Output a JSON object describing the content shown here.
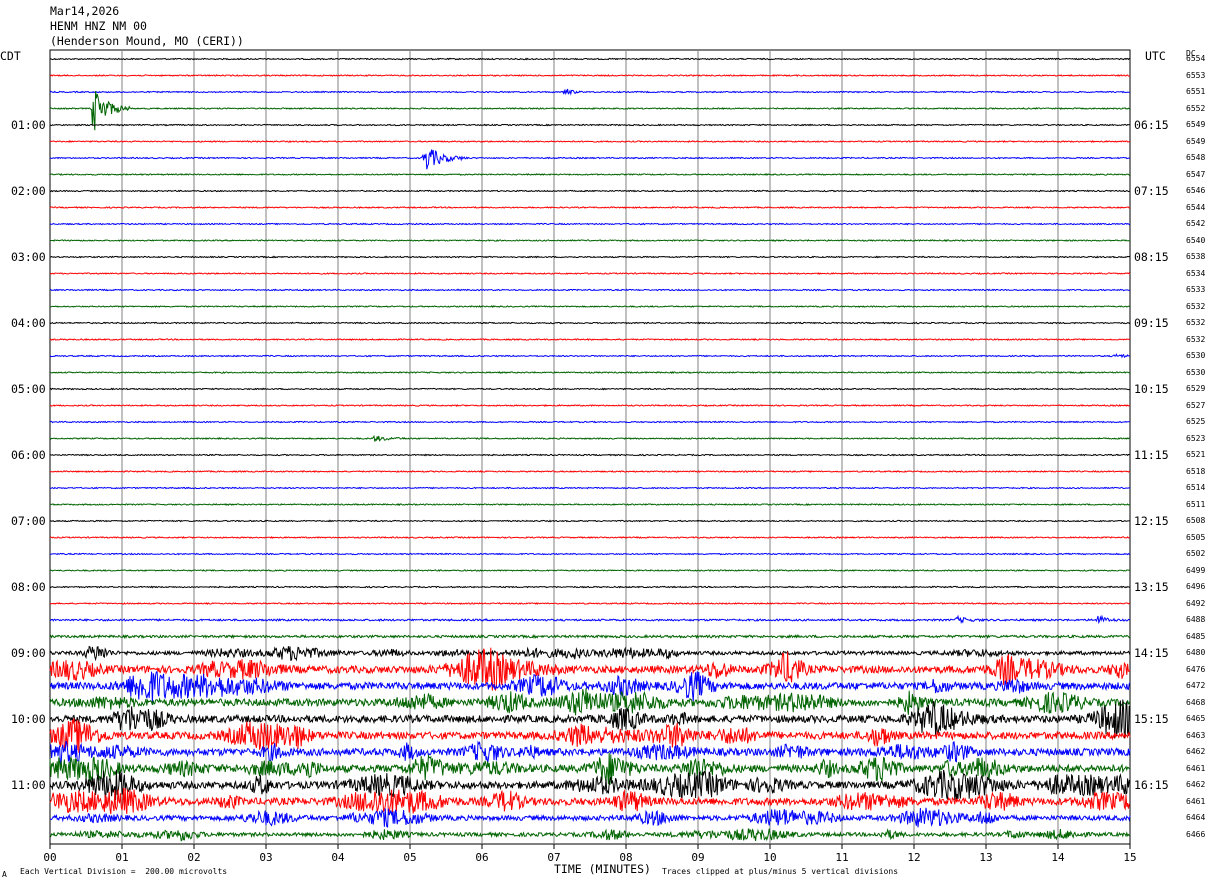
{
  "header": {
    "date": "Mar14,2026",
    "station": "HENM HNZ NM 00",
    "location": "(Henderson Mound, MO (CERI))"
  },
  "labels": {
    "left_tz": "CDT",
    "right_tz": "UTC",
    "dc_header": "DC",
    "xlabel": "TIME (MINUTES)",
    "scale_note": "Each Vertical Division =  200.00 microvolts",
    "clip_note": "Traces clipped at plus/minus 5 vertical divisions",
    "corner_mark": "A"
  },
  "colors": {
    "trace_cycle": [
      "#000000",
      "#ff0000",
      "#0000ff",
      "#006400"
    ],
    "grid": "#808080"
  },
  "chart_data": {
    "type": "line",
    "title": "HENM HNZ NM 00",
    "xlabel": "TIME (MINUTES)",
    "xlim": [
      0,
      15
    ],
    "x_ticks": [
      "00",
      "01",
      "02",
      "03",
      "04",
      "05",
      "06",
      "07",
      "08",
      "09",
      "10",
      "11",
      "12",
      "13",
      "14",
      "15"
    ],
    "lines_per_hour": 4,
    "line_count": 48,
    "left_hour_labels": [
      "01:00",
      "02:00",
      "03:00",
      "04:00",
      "05:00",
      "06:00",
      "07:00",
      "08:00",
      "09:00",
      "10:00",
      "11:00"
    ],
    "left_hour_line_index": [
      4,
      8,
      12,
      16,
      20,
      24,
      28,
      32,
      36,
      40,
      44
    ],
    "right_hour_labels": [
      "06:15",
      "07:15",
      "08:15",
      "09:15",
      "10:15",
      "11:15",
      "12:15",
      "13:15",
      "14:15",
      "15:15",
      "16:15"
    ],
    "right_hour_line_index": [
      4,
      8,
      12,
      16,
      20,
      24,
      28,
      32,
      36,
      40,
      44
    ],
    "dc_offsets": [
      6554,
      6553,
      6551,
      6552,
      6549,
      6549,
      6548,
      6547,
      6546,
      6544,
      6542,
      6540,
      6538,
      6534,
      6533,
      6532,
      6532,
      6532,
      6530,
      6530,
      6529,
      6527,
      6525,
      6523,
      6521,
      6518,
      6514,
      6511,
      6508,
      6505,
      6502,
      6499,
      6496,
      6492,
      6488,
      6485,
      6480,
      6476,
      6472,
      6468,
      6465,
      6463,
      6462,
      6461,
      6462,
      6461,
      6464,
      6466
    ],
    "noise_level": [
      1,
      1,
      1,
      1,
      1,
      1,
      1,
      1,
      1,
      1,
      1,
      1,
      1,
      1,
      1,
      1,
      1,
      1,
      1,
      1,
      1,
      1,
      1,
      1,
      1,
      1,
      1,
      1,
      1,
      1,
      1,
      1,
      1,
      1,
      1.5,
      2,
      3,
      6,
      6,
      6,
      6,
      6,
      6,
      6,
      6,
      6,
      4,
      3
    ],
    "events": [
      {
        "line": 3,
        "minute": 0.6,
        "amplitude": 24,
        "duration_min": 0.5
      },
      {
        "line": 2,
        "minute": 7.15,
        "amplitude": 4,
        "duration_min": 0.25
      },
      {
        "line": 6,
        "minute": 5.2,
        "amplitude": 14,
        "duration_min": 0.6
      },
      {
        "line": 23,
        "minute": 4.5,
        "amplitude": 3,
        "duration_min": 0.5
      },
      {
        "line": 18,
        "minute": 14.8,
        "amplitude": 2,
        "duration_min": 0.4
      },
      {
        "line": 34,
        "minute": 14.55,
        "amplitude": 5,
        "duration_min": 0.3
      },
      {
        "line": 34,
        "minute": 12.6,
        "amplitude": 3,
        "duration_min": 0.4
      }
    ]
  }
}
